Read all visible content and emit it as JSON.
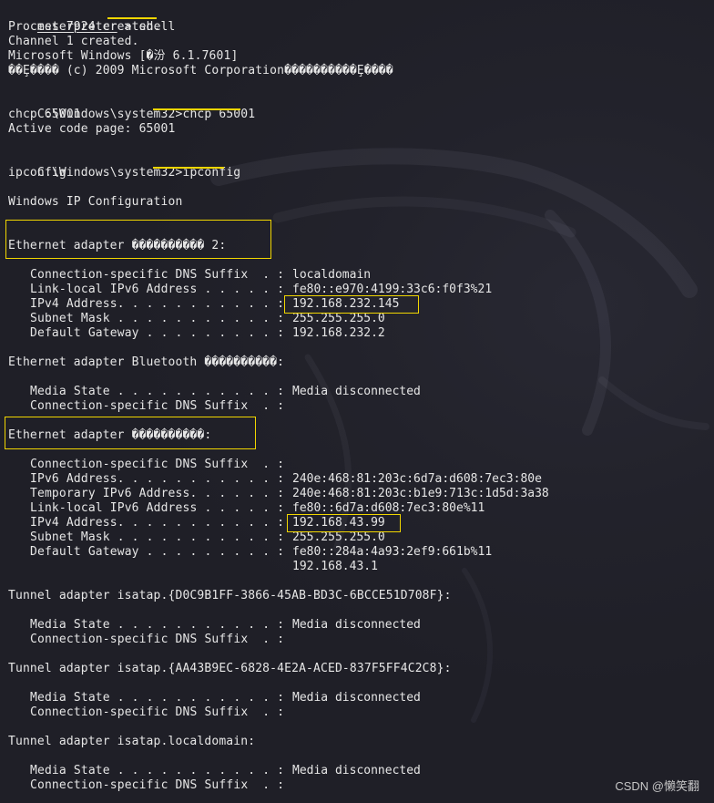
{
  "session": {
    "prompt_name": "meterpreter",
    "prompt_symbol": ">",
    "command": "shell"
  },
  "shell": {
    "process": "Process 7924 created.",
    "channel": "Channel 1 created.",
    "windows_line": "Microsoft Windows [�汾 6.1.7601]",
    "copyright_line": "��Ȩ���� (c) 2009 Microsoft Corporation����������Ȩ����"
  },
  "codepage": {
    "prompt": "C:\\Windows\\system32>",
    "command": "chcp 65001",
    "echo": "chcp 65001",
    "result": "Active code page: 65001"
  },
  "ipconfig": {
    "prompt": "C:\\Windows\\system32>",
    "command": "ipconfig",
    "echo": "ipconfig",
    "title": "Windows IP Configuration"
  },
  "adapters": {
    "a2": {
      "title": "Ethernet adapter ���������� 2:",
      "rows": [
        {
          "label": "Connection-specific DNS Suffix  . :",
          "value": "localdomain"
        },
        {
          "label": "Link-local IPv6 Address . . . . . :",
          "value": "fe80::e970:4199:33c6:f0f3%21"
        },
        {
          "label": "IPv4 Address. . . . . . . . . . . :",
          "value": "192.168.232.145"
        },
        {
          "label": "Subnet Mask . . . . . . . . . . . :",
          "value": "255.255.255.0"
        },
        {
          "label": "Default Gateway . . . . . . . . . :",
          "value": "192.168.232.2"
        }
      ]
    },
    "bt": {
      "title": "Ethernet adapter Bluetooth ����������:",
      "rows": [
        {
          "label": "Media State . . . . . . . . . . . :",
          "value": "Media disconnected"
        },
        {
          "label": "Connection-specific DNS Suffix  . :",
          "value": ""
        }
      ]
    },
    "local": {
      "title": "Ethernet adapter ����������:",
      "rows": [
        {
          "label": "Connection-specific DNS Suffix  . :",
          "value": ""
        },
        {
          "label": "IPv6 Address. . . . . . . . . . . :",
          "value": "240e:468:81:203c:6d7a:d608:7ec3:80e"
        },
        {
          "label": "Temporary IPv6 Address. . . . . . :",
          "value": "240e:468:81:203c:b1e9:713c:1d5d:3a38"
        },
        {
          "label": "Link-local IPv6 Address . . . . . :",
          "value": "fe80::6d7a:d608:7ec3:80e%11"
        },
        {
          "label": "IPv4 Address. . . . . . . . . . . :",
          "value": "192.168.43.99"
        },
        {
          "label": "Subnet Mask . . . . . . . . . . . :",
          "value": "255.255.255.0"
        },
        {
          "label": "Default Gateway . . . . . . . . . :",
          "value": "fe80::284a:4a93:2ef9:661b%11"
        },
        {
          "label": "",
          "value": "192.168.43.1"
        }
      ]
    },
    "t1": {
      "title": "Tunnel adapter isatap.{D0C9B1FF-3866-45AB-BD3C-6BCCE51D708F}:",
      "rows": [
        {
          "label": "Media State . . . . . . . . . . . :",
          "value": "Media disconnected"
        },
        {
          "label": "Connection-specific DNS Suffix  . :",
          "value": ""
        }
      ]
    },
    "t2": {
      "title": "Tunnel adapter isatap.{AA43B9EC-6828-4E2A-ACED-837F5FF4C2C8}:",
      "rows": [
        {
          "label": "Media State . . . . . . . . . . . :",
          "value": "Media disconnected"
        },
        {
          "label": "Connection-specific DNS Suffix  . :",
          "value": ""
        }
      ]
    },
    "t3": {
      "title": "Tunnel adapter isatap.localdomain:",
      "rows": [
        {
          "label": "Media State . . . . . . . . . . . :",
          "value": "Media disconnected"
        },
        {
          "label": "Connection-specific DNS Suffix  . :",
          "value": ""
        }
      ]
    }
  },
  "watermark": {
    "text": "CSDN @懒笑翻"
  },
  "colors": {
    "background": "#1f1f27",
    "text": "#e6e6e6",
    "highlight": "#f1d600"
  }
}
